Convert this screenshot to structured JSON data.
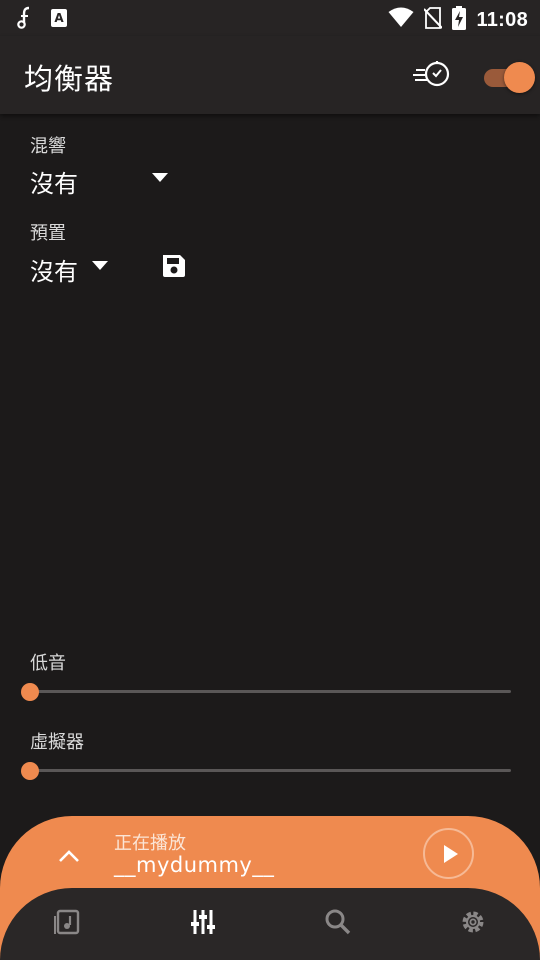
{
  "status_bar": {
    "time": "11:08",
    "icons": [
      "music-note-icon",
      "text-a-icon",
      "wifi-icon",
      "no-sim-icon",
      "battery-charging-icon"
    ]
  },
  "app_bar": {
    "title": "均衡器",
    "speed_icon": "speed-timer-icon",
    "equalizer_enabled": true
  },
  "reverb": {
    "label": "混響",
    "value": "沒有"
  },
  "preset": {
    "label": "預置",
    "value": "沒有",
    "save_icon": "save-icon"
  },
  "bass": {
    "label": "低音",
    "level": 0
  },
  "virtualizer": {
    "label": "虛擬器",
    "level": 0
  },
  "now_playing": {
    "label": "正在播放",
    "title": "__mydummy__",
    "expand_icon": "chevron-up-icon",
    "play_icon": "play-icon"
  },
  "bottom_nav": {
    "items": [
      {
        "icon": "library-icon",
        "active": false
      },
      {
        "icon": "equalizer-icon",
        "active": true
      },
      {
        "icon": "search-icon",
        "active": false
      },
      {
        "icon": "settings-icon",
        "active": false
      }
    ]
  },
  "colors": {
    "accent": "#ef8a4f",
    "background": "#1c1a1a",
    "app_bar": "#272424",
    "nav_bar": "#2a2727"
  }
}
